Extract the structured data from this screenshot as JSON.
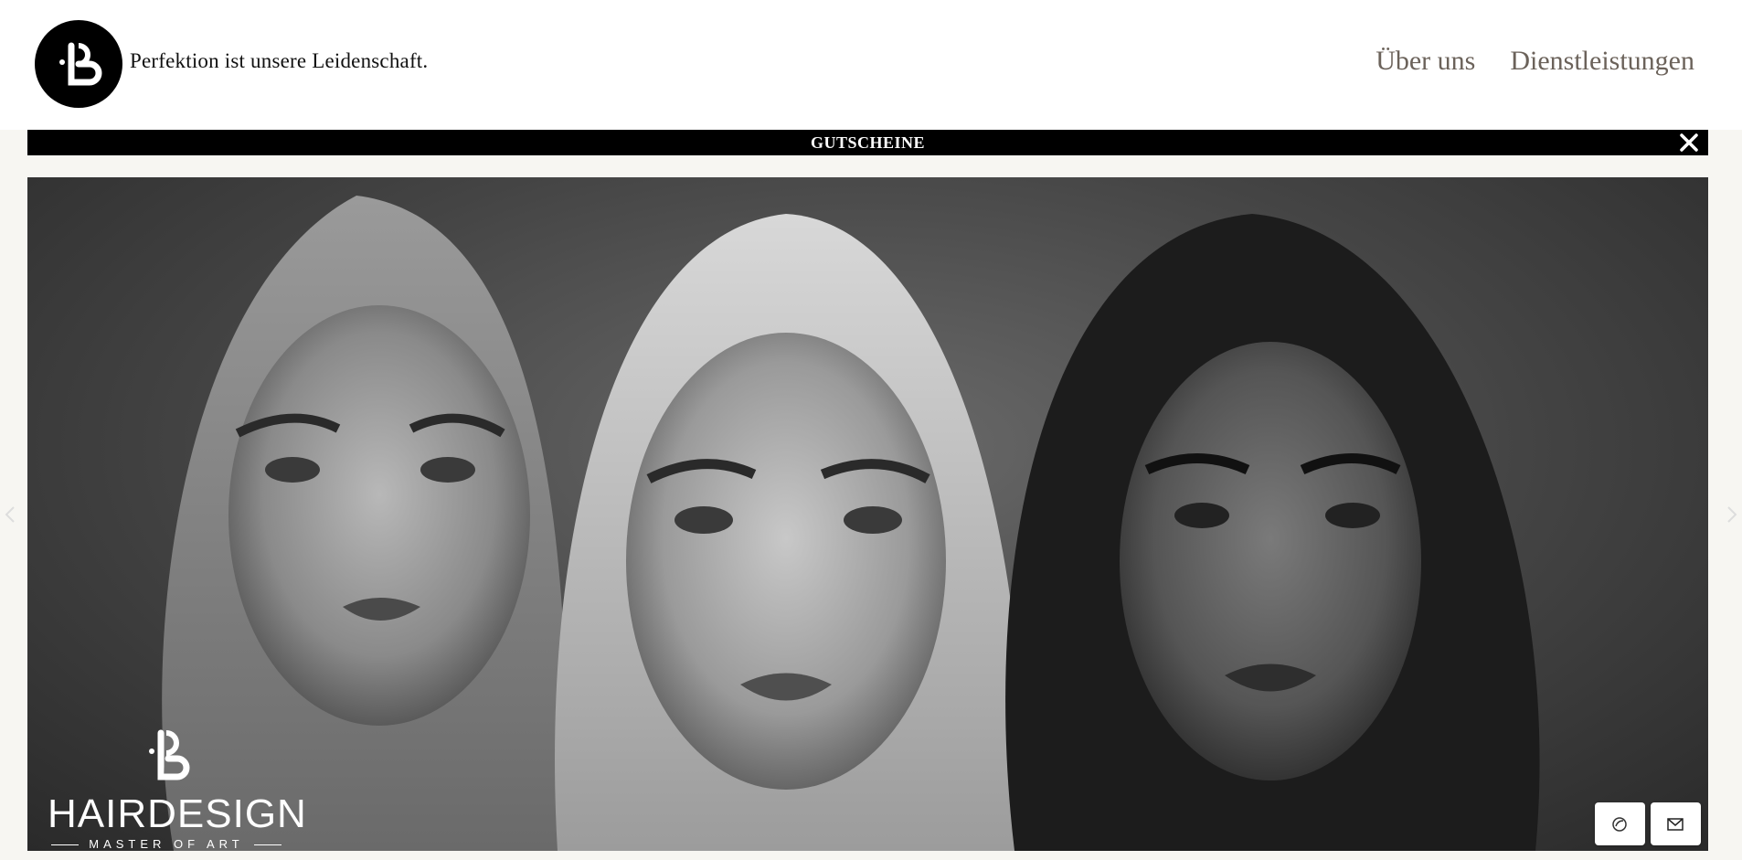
{
  "header": {
    "tagline": "Perfektion ist unsere Leidenschaft.",
    "logo_icon": "pb-monogram-icon",
    "nav": [
      {
        "label": "Über uns"
      },
      {
        "label": "Dienstleistungen"
      }
    ]
  },
  "banner": {
    "text": "GUTSCHEINE",
    "close_icon": "close-icon",
    "background": "#000000"
  },
  "hero": {
    "image": "three-women-monochrome-portrait",
    "brand_name": "HAIRDESIGN",
    "brand_sub": "MASTER OF ART"
  },
  "contact": {
    "phone_icon": "phone-icon",
    "mail_icon": "mail-icon"
  },
  "colors": {
    "accent_text": "#6b625a",
    "page_background": "#f7f6f2"
  }
}
